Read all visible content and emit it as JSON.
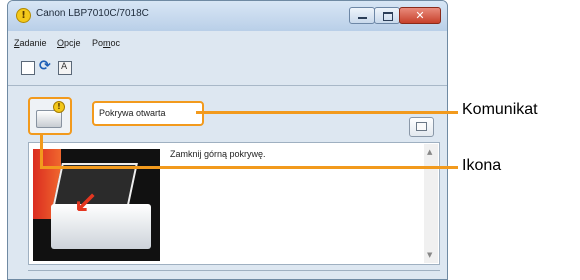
{
  "window": {
    "title": "Canon LBP7010C/7018C",
    "title_icon": "warning-badge-icon",
    "controls": {
      "close_glyph": "✕"
    }
  },
  "menu": [
    {
      "key": "Z",
      "rest": "adanie"
    },
    {
      "key": "O",
      "rest": "pcje"
    },
    {
      "pre": "Po",
      "key": "m",
      "rest": "oc"
    }
  ],
  "toolbar": {
    "icons": [
      "page-icon",
      "refresh-icon",
      "status-monitor-icon"
    ]
  },
  "status": {
    "message": "Pokrywa otwarta",
    "icon": "printer-warning-icon"
  },
  "detail": {
    "text": "Zamknij górną pokrywę.",
    "illustration": "printer-open-cover-illustration"
  },
  "callouts": {
    "message_label": "Komunikat",
    "icon_label": "Ikona",
    "color": "#f29a1d"
  }
}
